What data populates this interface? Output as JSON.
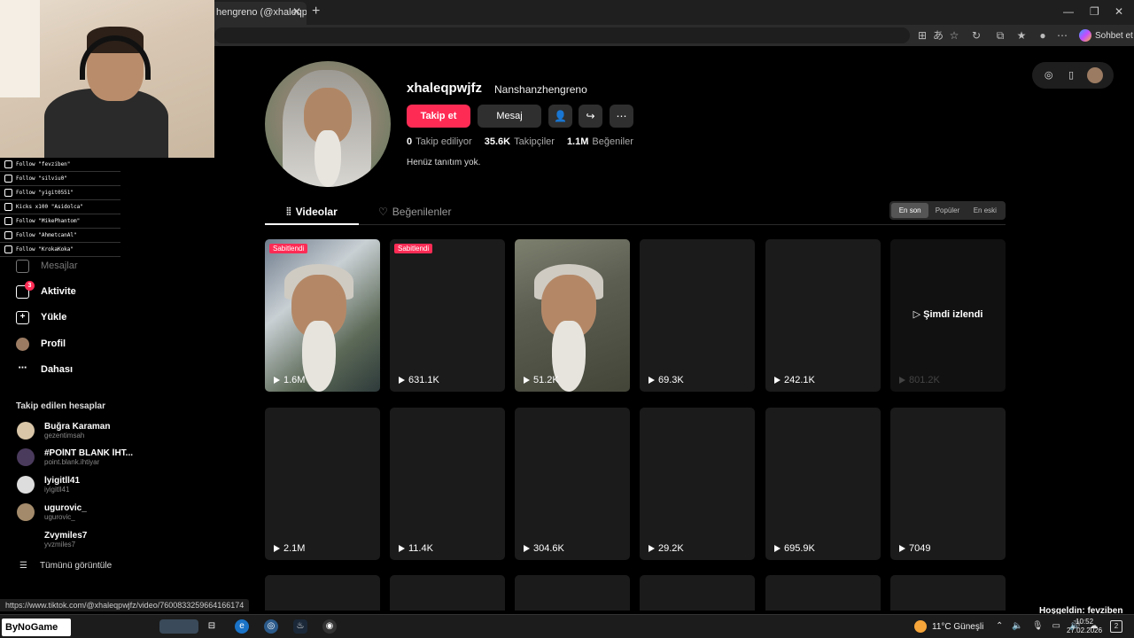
{
  "browser": {
    "tab_title": "hengreno (@xhaleqpwjfz",
    "sohbet_label": "Sohbet et",
    "status_url": "https://www.tiktok.com/@xhaleqpwjfz/video/7600833259664166174"
  },
  "overlay": {
    "events": [
      "Follow \"fevziben\"",
      "Follow \"silviu0\"",
      "Follow \"yigit0551\"",
      "Kicks x100 \"Asidolca\"",
      "Follow \"MikePhantom\"",
      "Follow \"AhmetcanAl\"",
      "Follow \"KrokaKoka\""
    ]
  },
  "sidebar": {
    "nav": [
      {
        "label": "Mesajlar",
        "faded": true
      },
      {
        "label": "Aktivite",
        "badge": "3"
      },
      {
        "label": "Yükle"
      },
      {
        "label": "Profil"
      },
      {
        "label": "Dahası"
      }
    ],
    "following_title": "Takip edilen hesaplar",
    "accounts": [
      {
        "name": "Buğra Karaman",
        "handle": "gezentimsah"
      },
      {
        "name": "#POİNT BLANK İHT...",
        "handle": "point.blank.ihtiyar"
      },
      {
        "name": "İyigitll41",
        "handle": "iyigitll41"
      },
      {
        "name": "ugurovic_",
        "handle": "ugurovic_"
      },
      {
        "name": "Zvymiles7",
        "handle": "yvzmiles7"
      }
    ],
    "see_all": "Tümünü görüntüle"
  },
  "profile": {
    "username": "xhaleqpwjfz",
    "nickname": "Nanshanzhengreno",
    "follow_label": "Takip et",
    "message_label": "Mesaj",
    "stats": [
      {
        "value": "0",
        "label": "Takip ediliyor"
      },
      {
        "value": "35.6K",
        "label": "Takipçiler"
      },
      {
        "value": "1.1M",
        "label": "Beğeniler"
      }
    ],
    "bio": "Henüz tanıtım yok."
  },
  "tabs": {
    "videos": "Videolar",
    "liked": "Beğenilenler"
  },
  "sort": [
    "En son",
    "Popüler",
    "En eski"
  ],
  "pinned_label": "Sabitlendi",
  "watched_label": "Şimdi izlendi",
  "videos_row1": [
    "1.6M",
    "631.1K",
    "51.2K",
    "69.3K",
    "242.1K",
    "801.2K"
  ],
  "videos_row2": [
    "2.1M",
    "11.4K",
    "304.6K",
    "29.2K",
    "695.9K",
    "7049"
  ],
  "taskbar": {
    "bynogame": "ByNoGame",
    "weather": "11°C  Güneşli",
    "time": "10:52",
    "date": "27.02.2026",
    "notifications": "2",
    "welcome": "Hoşgeldin: fevziben"
  }
}
